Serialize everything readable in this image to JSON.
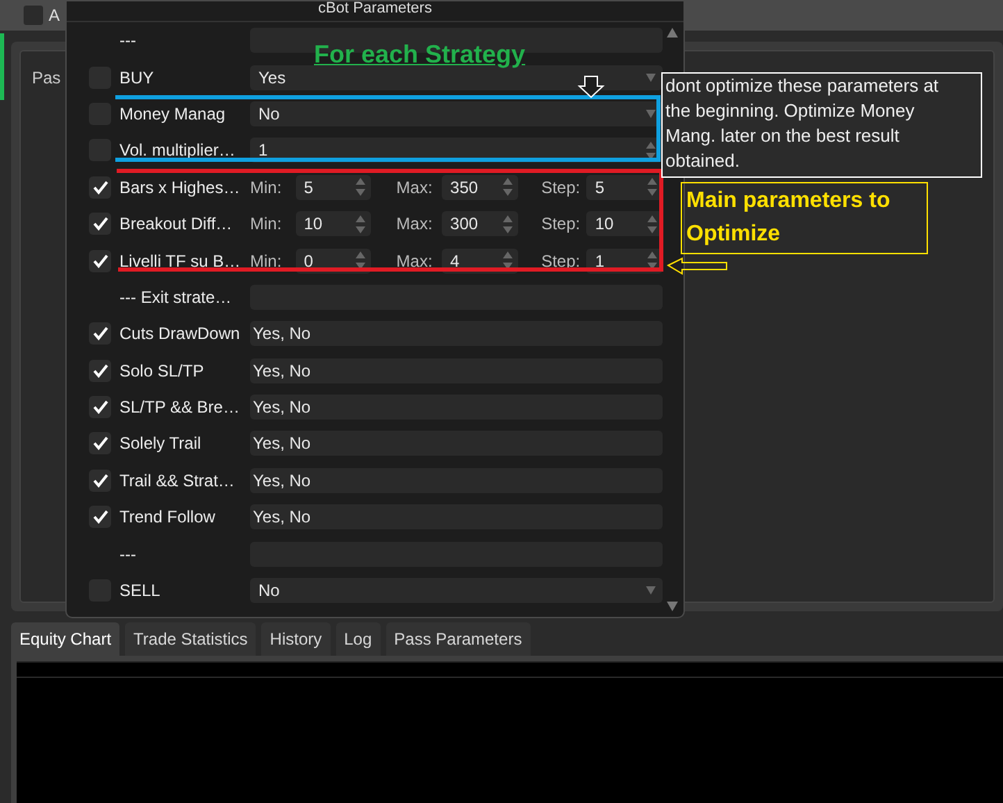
{
  "app": {
    "top_bar_checked": false,
    "top_bar_label": "A",
    "panel_label": "Pas"
  },
  "dialog": {
    "title": "cBot Parameters",
    "rows": [
      {
        "kind": "separator",
        "label": "---"
      },
      {
        "kind": "select",
        "label": "BUY",
        "checked": false,
        "value": "Yes"
      },
      {
        "kind": "select",
        "label": "Money Manag",
        "checked": false,
        "value": "No"
      },
      {
        "kind": "number",
        "label": "Vol. multiplier…",
        "checked": false,
        "value": "1"
      },
      {
        "kind": "range",
        "label": "Bars x Highes…",
        "checked": true,
        "min_label": "Min:",
        "min": "5",
        "max_label": "Max:",
        "max": "350",
        "step_label": "Step:",
        "step": "5"
      },
      {
        "kind": "range",
        "label": "Breakout Diff…",
        "checked": true,
        "min_label": "Min:",
        "min": "10",
        "max_label": "Max:",
        "max": "300",
        "step_label": "Step:",
        "step": "10"
      },
      {
        "kind": "range",
        "label": "Livelli TF su B…",
        "checked": true,
        "min_label": "Min:",
        "min": "0",
        "max_label": "Max:",
        "max": "4",
        "step_label": "Step:",
        "step": "1"
      },
      {
        "kind": "separator",
        "label": "--- Exit strate…"
      },
      {
        "kind": "list",
        "label": "Cuts DrawDown",
        "checked": true,
        "value": "Yes, No"
      },
      {
        "kind": "list",
        "label": "Solo SL/TP",
        "checked": true,
        "value": "Yes, No"
      },
      {
        "kind": "list",
        "label": "SL/TP && Bre…",
        "checked": true,
        "value": "Yes, No"
      },
      {
        "kind": "list",
        "label": "Solely Trail",
        "checked": true,
        "value": "Yes, No"
      },
      {
        "kind": "list",
        "label": "Trail && Strat…",
        "checked": true,
        "value": "Yes, No"
      },
      {
        "kind": "list",
        "label": "Trend Follow",
        "checked": true,
        "value": "Yes, No"
      },
      {
        "kind": "separator",
        "label": "---"
      },
      {
        "kind": "select",
        "label": "SELL",
        "checked": false,
        "value": "No"
      }
    ]
  },
  "tabs": [
    {
      "label": "Equity Chart",
      "selected": true
    },
    {
      "label": "Trade Statistics",
      "selected": false
    },
    {
      "label": "History",
      "selected": false
    },
    {
      "label": "Log",
      "selected": false
    },
    {
      "label": "Pass Parameters",
      "selected": false
    }
  ],
  "annotations": {
    "heading": "For each Strategy",
    "note": "dont optimize these parameters at the beginning. Optimize Money Mang.  later on the best result obtained.",
    "callout": "Main parameters to Optimize"
  }
}
